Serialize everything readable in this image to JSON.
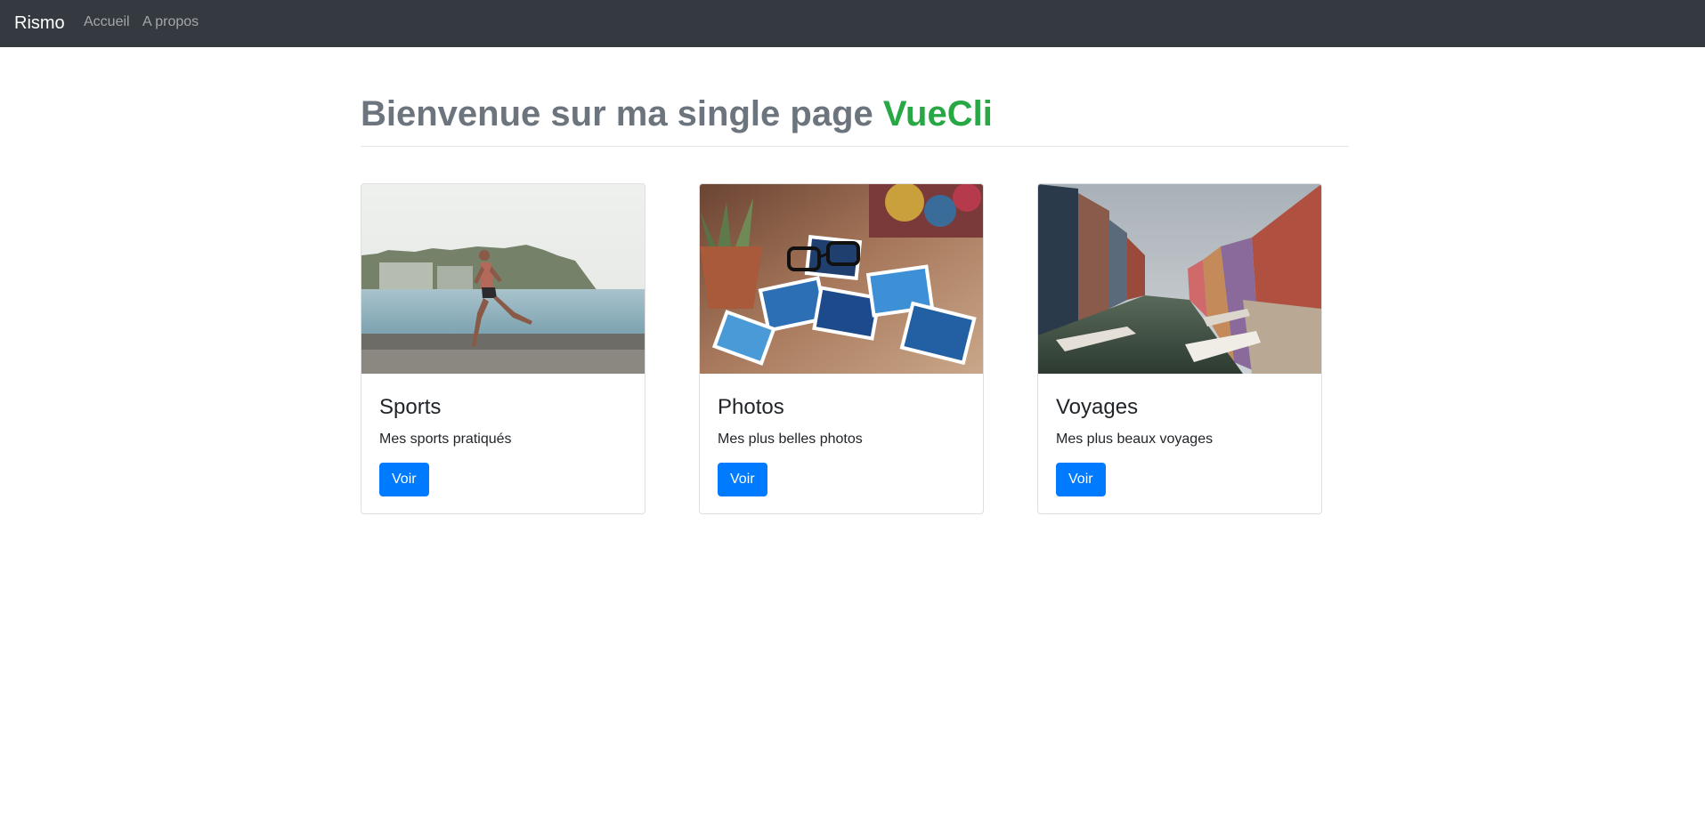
{
  "navbar": {
    "brand": "Rismo",
    "links": [
      {
        "label": "Accueil"
      },
      {
        "label": "A propos"
      }
    ]
  },
  "main": {
    "heading_prefix": "Bienvenue sur ma single page ",
    "heading_accent": "VueCli",
    "cards": [
      {
        "title": "Sports",
        "text": "Mes sports pratiqués",
        "button": "Voir",
        "image": "runner on seaside promenade photo"
      },
      {
        "title": "Photos",
        "text": "Mes plus belles photos",
        "button": "Voir",
        "image": "scattered printed photos with glasses and plant photo"
      },
      {
        "title": "Voyages",
        "text": "Mes plus beaux voyages",
        "button": "Voir",
        "image": "colorful houses along canal with boats photo"
      }
    ]
  },
  "colors": {
    "navbar_bg": "#343a40",
    "accent_green": "#28a745",
    "heading_gray": "#6c757d",
    "button_blue": "#007bff"
  }
}
